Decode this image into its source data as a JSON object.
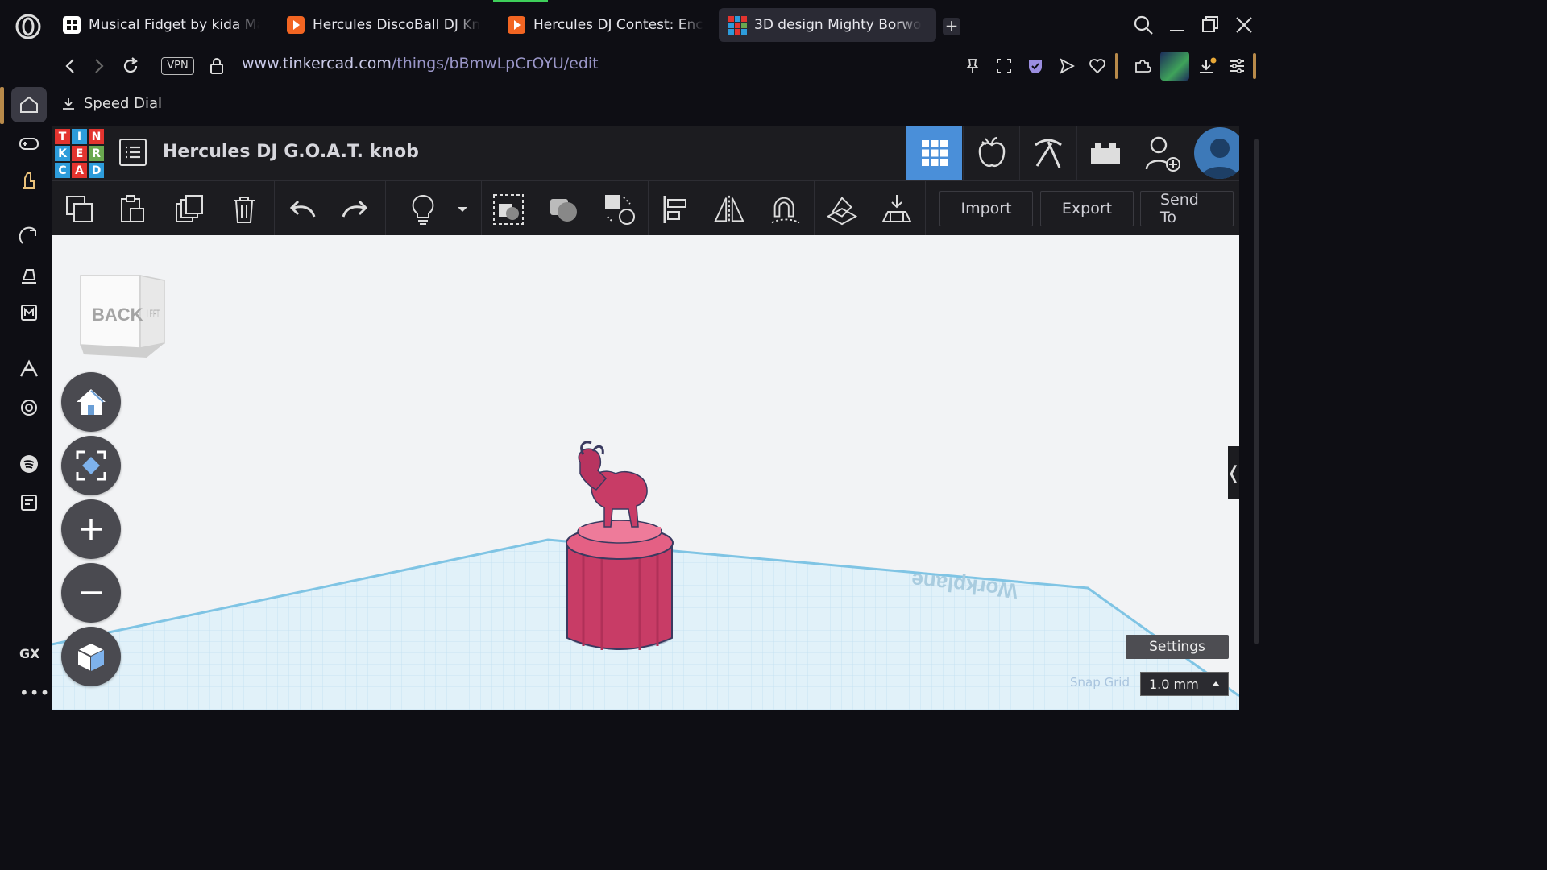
{
  "browser": {
    "tabs": [
      {
        "title": "Musical Fidget by kida Ma",
        "favicon": "printables-icon",
        "active": false
      },
      {
        "title": "Hercules DiscoBall DJ Kn",
        "favicon": "instructables-icon",
        "active": false
      },
      {
        "title": "Hercules DJ Contest: Enc",
        "favicon": "instructables-icon",
        "active": false
      },
      {
        "title": "3D design Mighty Borwo",
        "favicon": "tinkercad-icon",
        "active": true
      }
    ],
    "vpn_label": "VPN",
    "url_host": "www.tinkercad.com",
    "url_path": "/things/bBmwLpCrOYU/edit",
    "bookmark_label": "Speed Dial"
  },
  "tinkercad": {
    "logo_letters": [
      "T",
      "I",
      "N",
      "K",
      "E",
      "R",
      "C",
      "A",
      "D"
    ],
    "logo_colors": [
      "#e3342f",
      "#2d9cdb",
      "#e3342f",
      "#2d9cdb",
      "#e3342f",
      "#6aa84f",
      "#2d9cdb",
      "#e3342f",
      "#2d9cdb"
    ],
    "design_title": "Hercules DJ G.O.A.T. knob",
    "toolbar": {
      "import_label": "Import",
      "export_label": "Export",
      "send_to_label": "Send To"
    },
    "viewcube": {
      "front": "BACK",
      "side": "LEFT"
    },
    "workplane_label": "Workplane",
    "settings_label": "Settings",
    "snap_grid_label": "Snap Grid",
    "snap_grid_value": "1.0 mm",
    "accent_color": "#4a8fd9",
    "model_color": "#c83c66"
  }
}
